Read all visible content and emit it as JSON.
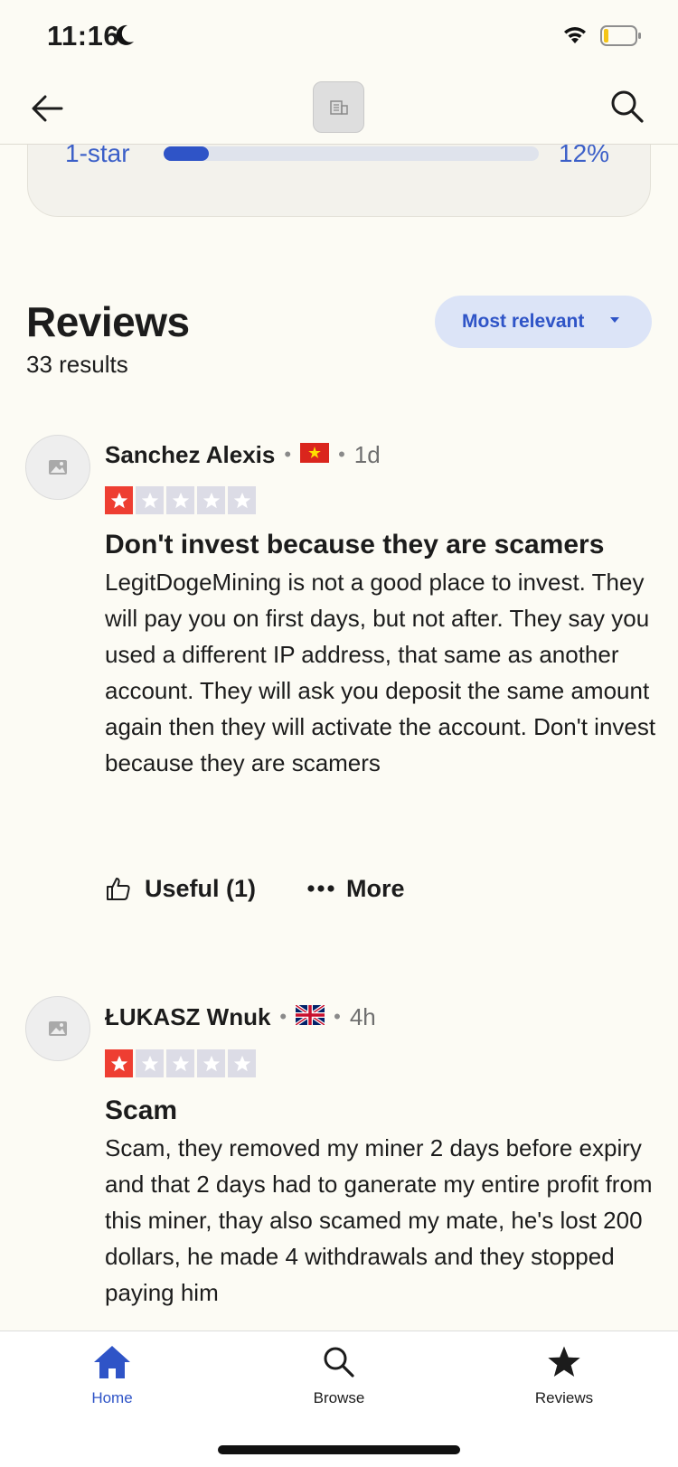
{
  "status_bar": {
    "time": "11:16"
  },
  "rating_bar": {
    "label": "1-star",
    "percent_text": "12%",
    "fill_fraction": 0.12
  },
  "reviews_header": {
    "title": "Reviews",
    "results": "33 results",
    "sort_label": "Most relevant"
  },
  "reviews": [
    {
      "name": "Sanchez Alexis",
      "flag": "vietnam-flag",
      "age": "1d",
      "stars": 1,
      "title": "Don't invest because they are scamers",
      "body": "LegitDogeMining is not a good place to invest. They will pay you on first days, but not after. They say you used a different IP address, that same as another account. They will ask you deposit the same amount again then they will activate the account. Don't invest because they are scamers",
      "useful_label": "Useful (1)",
      "more_label": "More"
    },
    {
      "name": "ŁUKASZ Wnuk",
      "flag": "uk-flag",
      "age": "4h",
      "stars": 1,
      "title": "Scam",
      "body": "Scam, they removed my miner 2 days before expiry and that 2 days had to ganerate my entire profit from this miner, thay also scamed my mate, he's lost 200 dollars, he made 4 withdrawals and they stopped paying him"
    }
  ],
  "bottom_nav": {
    "home": "Home",
    "browse": "Browse",
    "reviews": "Reviews",
    "active_color": "#2f54c7"
  }
}
